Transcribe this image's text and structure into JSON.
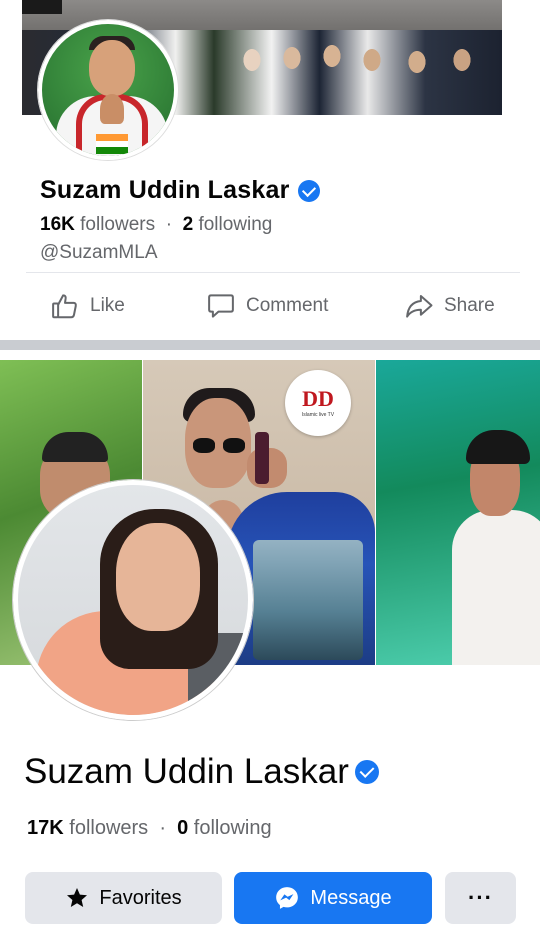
{
  "post": {
    "page_name": "Suzam Uddin Laskar",
    "verified": true,
    "followers_count": "16K",
    "followers_label": "followers",
    "separator": "·",
    "following_count": "2",
    "following_label": "following",
    "handle": "@SuzamMLA",
    "actions": {
      "like": "Like",
      "comment": "Comment",
      "share": "Share"
    }
  },
  "profile": {
    "name": "Suzam Uddin Laskar",
    "verified": true,
    "cover_logo_text": "DD",
    "cover_logo_subtext": "Islamic live TV",
    "followers_count": "17K",
    "followers_label": "followers",
    "separator": "·",
    "following_count": "0",
    "following_label": "following",
    "buttons": {
      "favorites": "Favorites",
      "message": "Message",
      "more": "···"
    }
  },
  "icons": {
    "like": "thumbs-up-icon",
    "comment": "comment-bubble-icon",
    "share": "share-arrow-icon",
    "verified": "verified-badge-icon",
    "favorites": "star-icon",
    "message": "messenger-icon"
  },
  "colors": {
    "accent": "#1877f2",
    "secondary_text": "#65676b",
    "button_gray": "#e4e6eb"
  }
}
